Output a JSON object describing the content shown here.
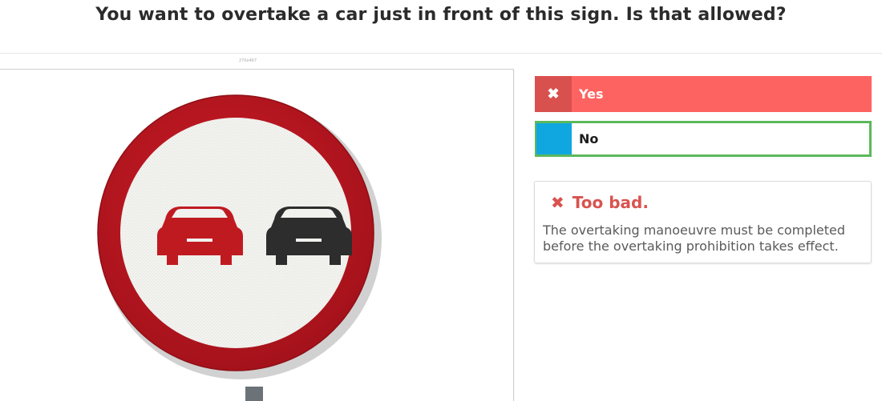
{
  "question": {
    "title": "You want to overtake a car just in front of this sign. Is that allowed?"
  },
  "image": {
    "caption": "270x467",
    "left_car_color": "#c01a21",
    "right_car_color": "#2d2d2d",
    "ring_color": "#b8151e"
  },
  "answers": [
    {
      "label": "Yes",
      "state": "selected-wrong",
      "icon": "cross-icon",
      "mark": "✖"
    },
    {
      "label": "No",
      "state": "correct",
      "icon": "",
      "mark": ""
    }
  ],
  "feedback": {
    "icon": "cross-icon",
    "mark": "✖",
    "title": "Too bad.",
    "body": "The overtaking manoeuvre must be completed before the overtaking prohibition takes effect."
  },
  "colors": {
    "wrong": "#fd6461",
    "wrong_dark": "#d8514e",
    "correct_border": "#5cb85c",
    "neutral_mark": "#10a7e1",
    "feedback_title": "#d9534f"
  }
}
